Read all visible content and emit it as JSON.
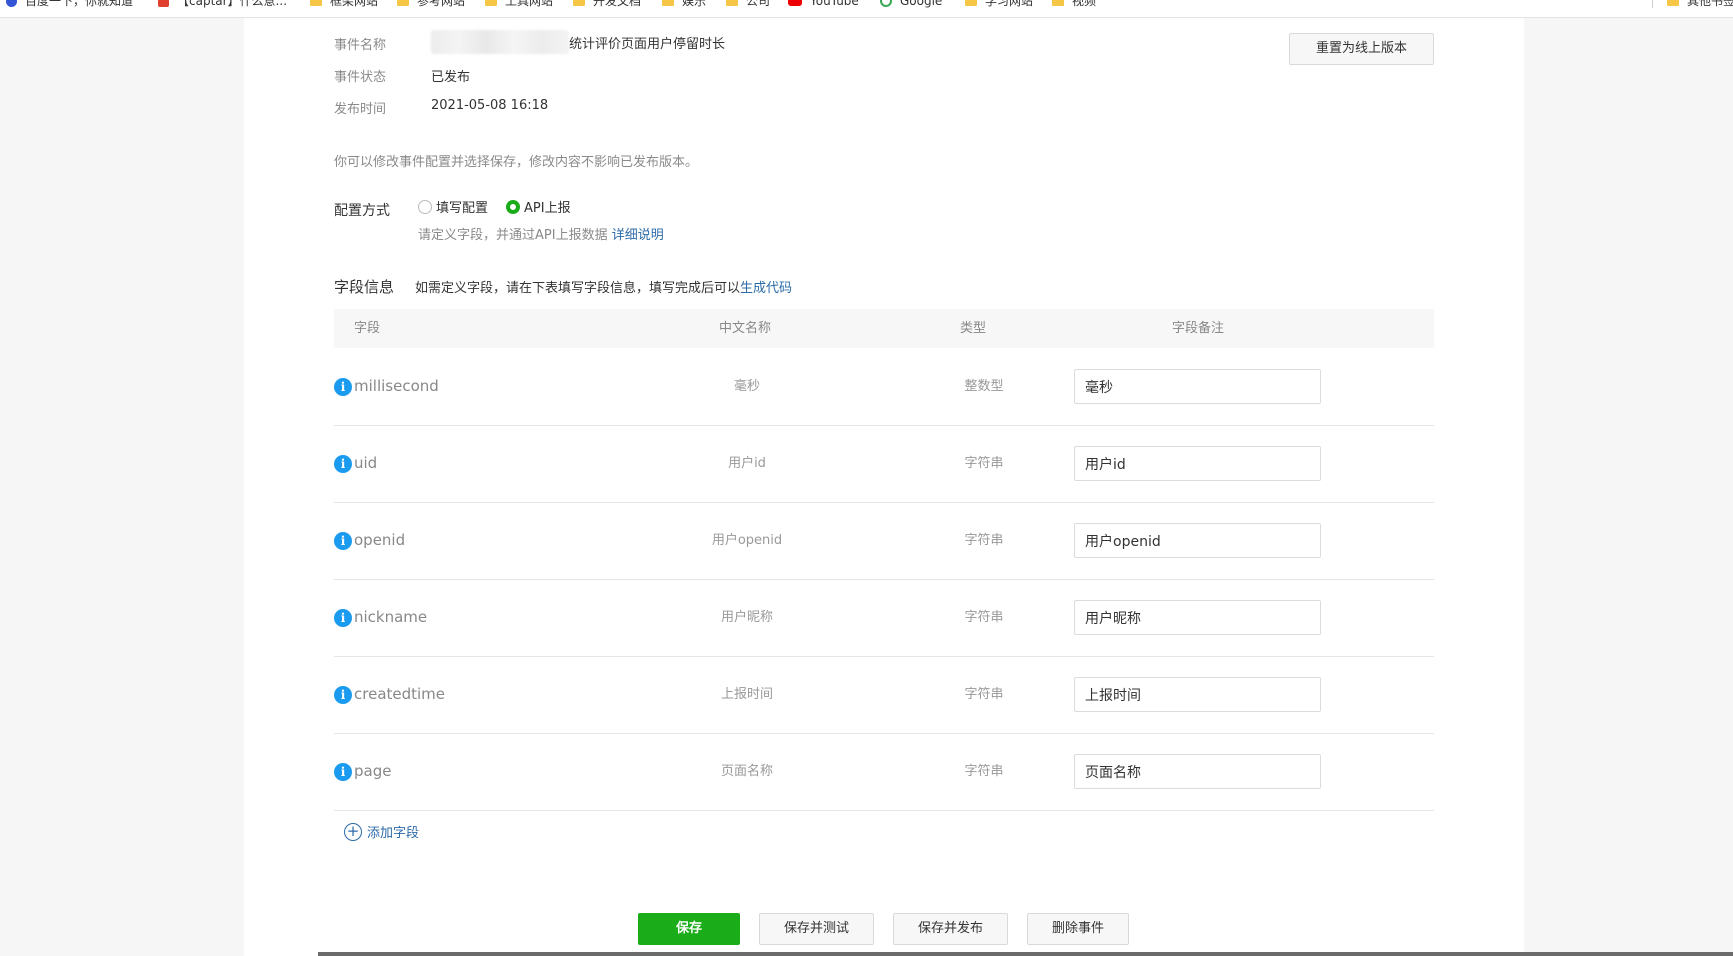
{
  "bookmarks": [
    {
      "label": "百度一下，你就知道",
      "icon": "baidu-icon"
    },
    {
      "label": "【captar】什么意...",
      "icon": "captar-icon"
    },
    {
      "label": "框架网站",
      "icon": "folder-icon"
    },
    {
      "label": "参考网站",
      "icon": "folder-icon"
    },
    {
      "label": "工具网站",
      "icon": "folder-icon"
    },
    {
      "label": "开发文档",
      "icon": "folder-icon"
    },
    {
      "label": "娱乐",
      "icon": "folder-icon"
    },
    {
      "label": "公司",
      "icon": "folder-icon"
    },
    {
      "label": "YouTube",
      "icon": "youtube-icon"
    },
    {
      "label": "Google",
      "icon": "google-icon"
    },
    {
      "label": "学习网站",
      "icon": "folder-icon"
    },
    {
      "label": "视频",
      "icon": "folder-icon"
    },
    {
      "label": "其他书签",
      "icon": "folder-icon"
    }
  ],
  "event": {
    "name_label": "事件名称",
    "name_value": "统计评价页面用户停留时长",
    "status_label": "事件状态",
    "status_value": "已发布",
    "time_label": "发布时间",
    "time_value": "2021-05-08 16:18"
  },
  "reset_button": "重置为线上版本",
  "edit_hint": "你可以修改事件配置并选择保存，修改内容不影响已发布版本。",
  "config": {
    "label": "配置方式",
    "options": [
      {
        "label": "填写配置",
        "checked": false
      },
      {
        "label": "API上报",
        "checked": true
      }
    ],
    "hint": "请定义字段，并通过API上报数据",
    "hint_link": "详细说明"
  },
  "fields": {
    "title": "字段信息",
    "desc": "如需定义字段，请在下表填写字段信息，填写完成后可以",
    "desc_link": "生成代码",
    "columns": [
      "字段",
      "中文名称",
      "类型",
      "字段备注"
    ],
    "rows": [
      {
        "field": "millisecond",
        "cn_name": "毫秒",
        "type": "整数型",
        "remark": "毫秒"
      },
      {
        "field": "uid",
        "cn_name": "用户id",
        "type": "字符串",
        "remark": "用户id"
      },
      {
        "field": "openid",
        "cn_name": "用户openid",
        "type": "字符串",
        "remark": "用户openid"
      },
      {
        "field": "nickname",
        "cn_name": "用户昵称",
        "type": "字符串",
        "remark": "用户昵称"
      },
      {
        "field": "createdtime",
        "cn_name": "上报时间",
        "type": "字符串",
        "remark": "上报时间"
      },
      {
        "field": "page",
        "cn_name": "页面名称",
        "type": "字符串",
        "remark": "页面名称"
      }
    ],
    "add_label": "添加字段"
  },
  "actions": {
    "save": "保存",
    "save_test": "保存并测试",
    "save_publish": "保存并发布",
    "delete": "删除事件"
  },
  "colors": {
    "primary_green": "#1aad19",
    "link_blue": "#2d6ba8",
    "info_blue": "#1a9bf0"
  }
}
